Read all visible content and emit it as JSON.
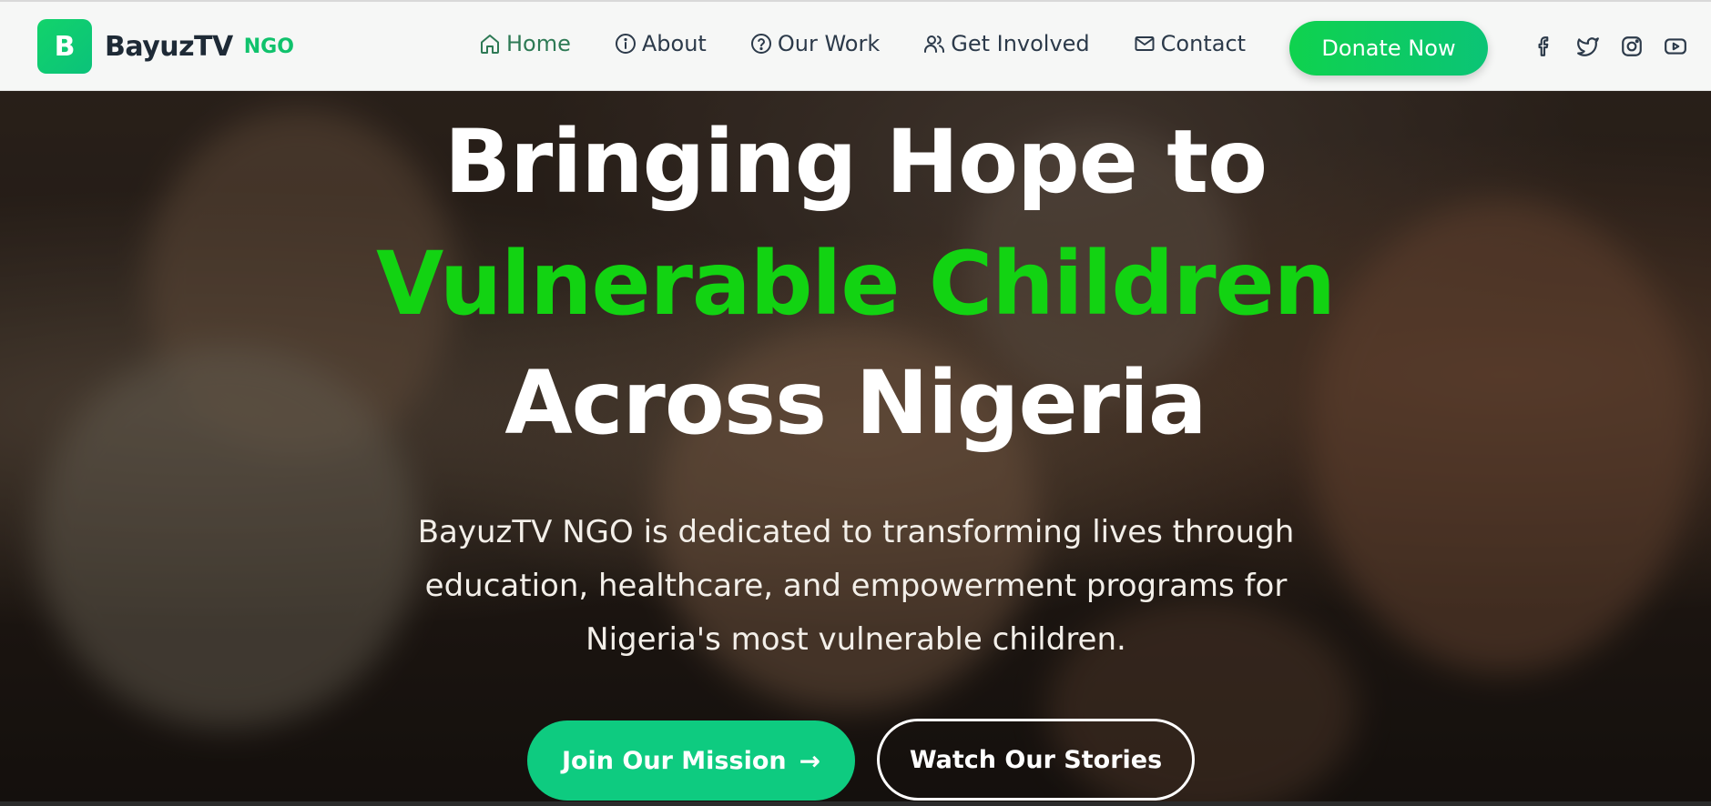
{
  "brand": {
    "logo_letter": "B",
    "name": "BayuzTV",
    "tag": "NGO",
    "accent": "#10c26c"
  },
  "nav": {
    "items": [
      {
        "label": "Home",
        "icon": "home-icon",
        "active": true
      },
      {
        "label": "About",
        "icon": "info-icon"
      },
      {
        "label": "Our Work",
        "icon": "help-circle-icon"
      },
      {
        "label": "Get Involved",
        "icon": "users-icon"
      },
      {
        "label": "Contact",
        "icon": "mail-icon"
      }
    ],
    "donate_label": "Donate Now"
  },
  "socials": [
    "facebook-icon",
    "twitter-icon",
    "instagram-icon",
    "youtube-icon"
  ],
  "hero": {
    "line1": "Bringing Hope to",
    "line2": "Vulnerable Children",
    "line3": "Across Nigeria",
    "subtext": "BayuzTV NGO is dedicated to transforming lives through education, healthcare, and empowerment programs for Nigeria's most vulnerable children.",
    "cta_primary": "Join Our Mission",
    "cta_secondary": "Watch Our Stories",
    "highlight_color": "#12d312"
  }
}
